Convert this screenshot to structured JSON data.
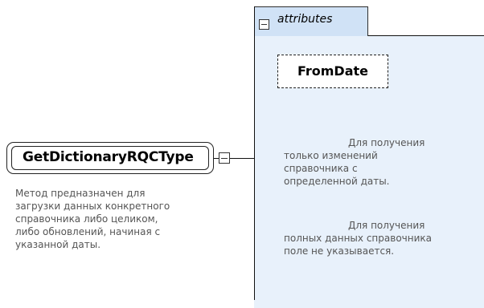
{
  "root": {
    "name": "GetDictionaryRQCType",
    "documentation": [
      "Метод предназначен для",
      "загрузки данных конкретного",
      "справочника либо целиком,",
      "либо обновлений, начиная с",
      "указанной даты."
    ]
  },
  "attributes_group": {
    "label": "attributes"
  },
  "attribute": {
    "name": "FromDate",
    "documentation_1": [
      "Для получения",
      "только изменений",
      "справочника с",
      "определенной даты."
    ],
    "documentation_2": [
      "Для получения",
      "полных данных справочника",
      "поле не указывается."
    ]
  },
  "colors": {
    "attributes_tab": "#d0e2f6",
    "attributes_body": "#e8f1fb",
    "annotation_text": "#555555"
  }
}
